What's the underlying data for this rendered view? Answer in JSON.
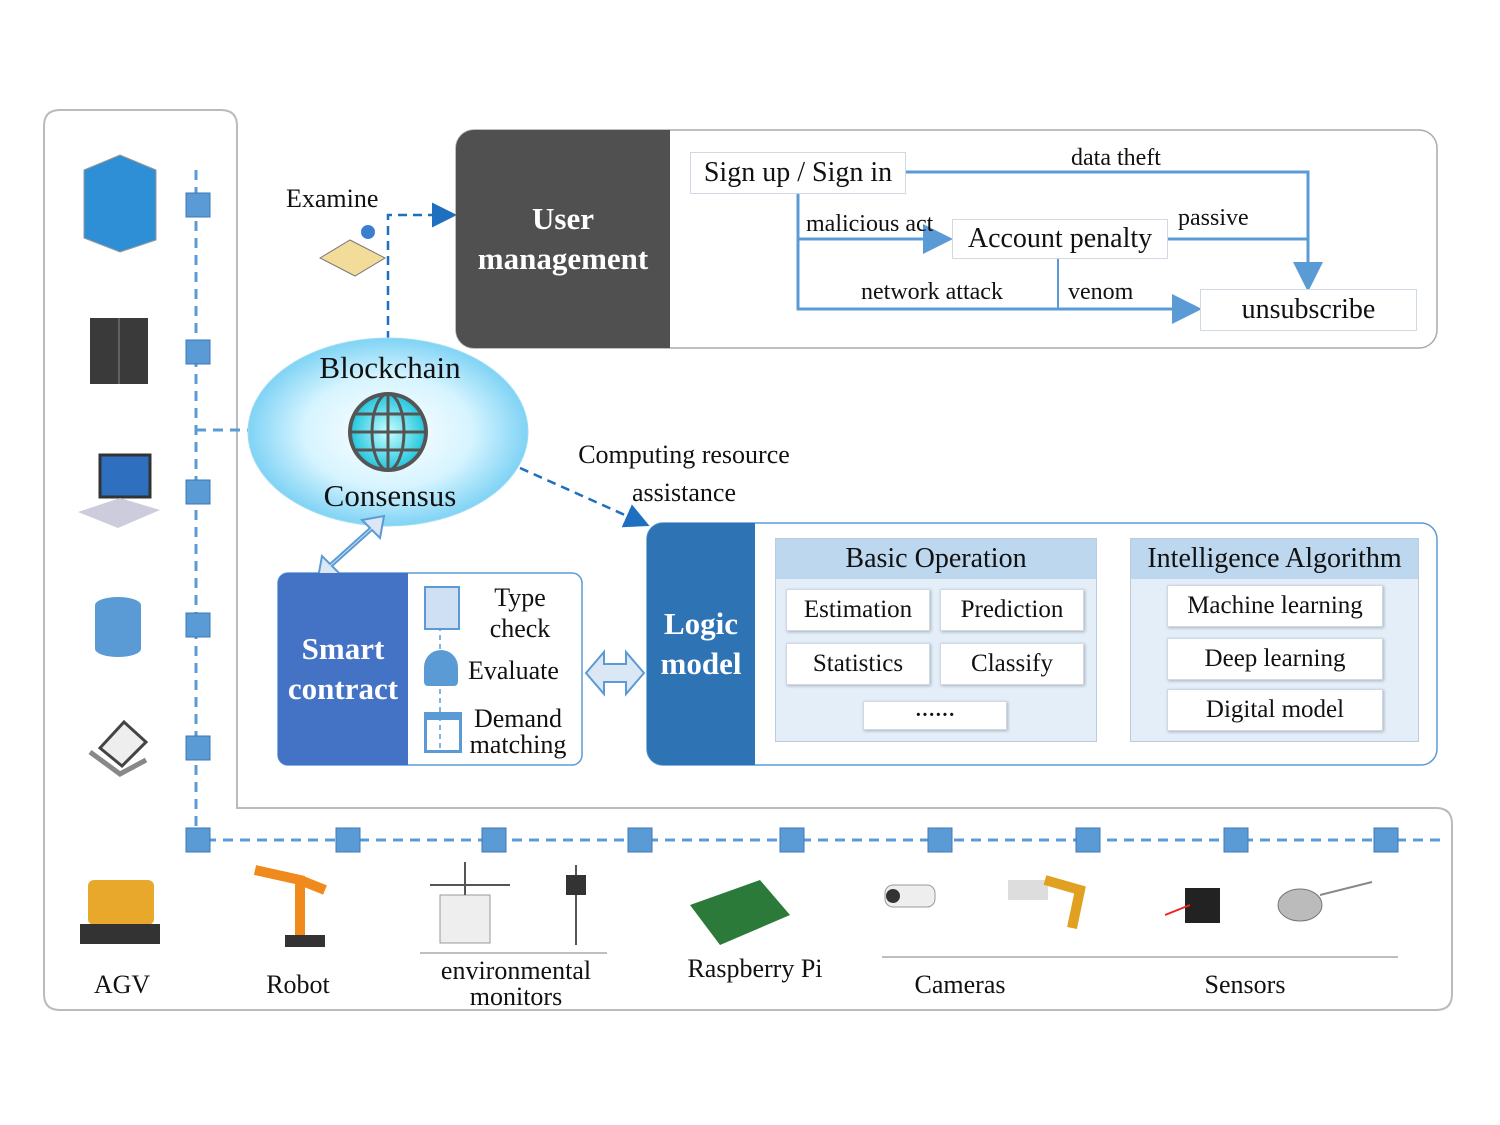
{
  "examine": "Examine",
  "user_management": {
    "title": "User management",
    "sign": "Sign up  / Sign in",
    "data_theft": "data theft",
    "malicious": "malicious act",
    "penalty": "Account penalty",
    "passive": "passive",
    "network": "network attack",
    "venom": "venom",
    "unsubscribe": "unsubscribe"
  },
  "blockchain": {
    "top": "Blockchain",
    "bottom": "Consensus"
  },
  "computing": {
    "line1": "Computing resource",
    "line2": "assistance"
  },
  "smart_contract": {
    "title": "Smart contract",
    "steps": [
      "Type check",
      "Evaluate",
      "Demand matching"
    ]
  },
  "logic_model": {
    "title": "Logic model",
    "basic": {
      "header": "Basic Operation",
      "items": [
        "Estimation",
        "Prediction",
        "Statistics",
        "Classify",
        "······"
      ]
    },
    "intelligence": {
      "header": "Intelligence Algorithm",
      "items": [
        "Machine learning",
        "Deep learning",
        "Digital model"
      ]
    }
  },
  "devices": [
    "AGV",
    "Robot",
    "environmental monitors",
    "Raspberry Pi",
    "Cameras",
    "Sensors"
  ],
  "colors": {
    "user_mgmt": "#505050",
    "smart_contract": "#4472c4",
    "logic_model": "#2e74b5",
    "line": "#5b9bd5",
    "panel": "#deebf7",
    "header": "#bdd7ee"
  }
}
